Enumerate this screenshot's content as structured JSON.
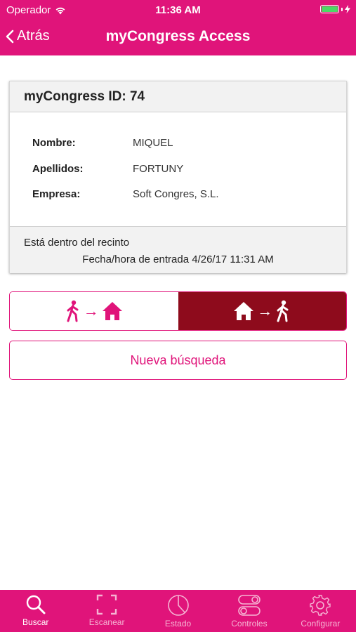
{
  "status_bar": {
    "carrier": "Operador",
    "time": "11:36 AM"
  },
  "nav": {
    "back_label": "Atrás",
    "title": "myCongress Access"
  },
  "card": {
    "id_title": "myCongress ID: 74",
    "fields": [
      {
        "label": "Nombre:",
        "value": "MIQUEL"
      },
      {
        "label": "Apellidos:",
        "value": "FORTUNY"
      },
      {
        "label": "Empresa:",
        "value": "Soft Congres, S.L."
      }
    ],
    "status_text": "Está dentro del recinto",
    "entry_label": "Fecha/hora de entrada 4/26/17 11:31 AM"
  },
  "toggle": {
    "selected": "exit",
    "enter_icon": "person-to-house",
    "exit_icon": "house-to-person"
  },
  "new_search_label": "Nueva búsqueda",
  "tabs": [
    {
      "label": "Buscar",
      "icon": "search-icon",
      "active": true
    },
    {
      "label": "Escanear",
      "icon": "scan-icon",
      "active": false
    },
    {
      "label": "Estado",
      "icon": "pie-chart-icon",
      "active": false
    },
    {
      "label": "Controles",
      "icon": "toggles-icon",
      "active": false
    },
    {
      "label": "Configurar",
      "icon": "gear-icon",
      "active": false
    }
  ],
  "colors": {
    "brand": "#e0147a",
    "exit_selected": "#8e0b1c",
    "battery": "#4cd964"
  }
}
